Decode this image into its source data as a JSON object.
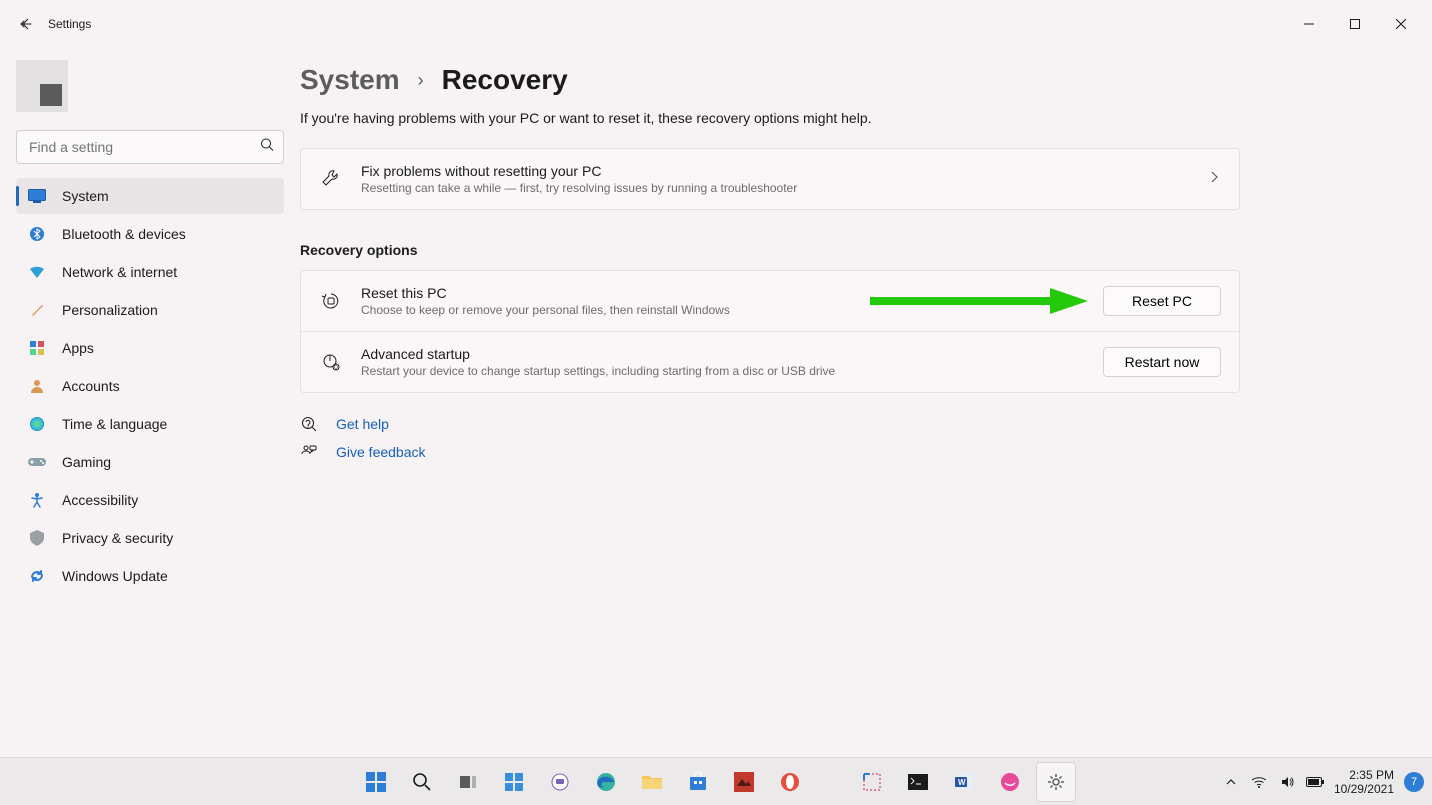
{
  "window": {
    "title": "Settings"
  },
  "search": {
    "placeholder": "Find a setting"
  },
  "nav": {
    "items": [
      {
        "label": "System",
        "active": true
      },
      {
        "label": "Bluetooth & devices"
      },
      {
        "label": "Network & internet"
      },
      {
        "label": "Personalization"
      },
      {
        "label": "Apps"
      },
      {
        "label": "Accounts"
      },
      {
        "label": "Time & language"
      },
      {
        "label": "Gaming"
      },
      {
        "label": "Accessibility"
      },
      {
        "label": "Privacy & security"
      },
      {
        "label": "Windows Update"
      }
    ]
  },
  "breadcrumb": {
    "parent": "System",
    "current": "Recovery"
  },
  "subtitle": "If you're having problems with your PC or want to reset it, these recovery options might help.",
  "fixcard": {
    "title": "Fix problems without resetting your PC",
    "sub": "Resetting can take a while — first, try resolving issues by running a troubleshooter"
  },
  "section_header": "Recovery options",
  "reset_card": {
    "title": "Reset this PC",
    "sub": "Choose to keep or remove your personal files, then reinstall Windows",
    "button": "Reset PC"
  },
  "adv_card": {
    "title": "Advanced startup",
    "sub": "Restart your device to change startup settings, including starting from a disc or USB drive",
    "button": "Restart now"
  },
  "links": {
    "help": "Get help",
    "feedback": "Give feedback"
  },
  "tray": {
    "time": "2:35 PM",
    "date": "10/29/2021",
    "notif_count": "7"
  }
}
